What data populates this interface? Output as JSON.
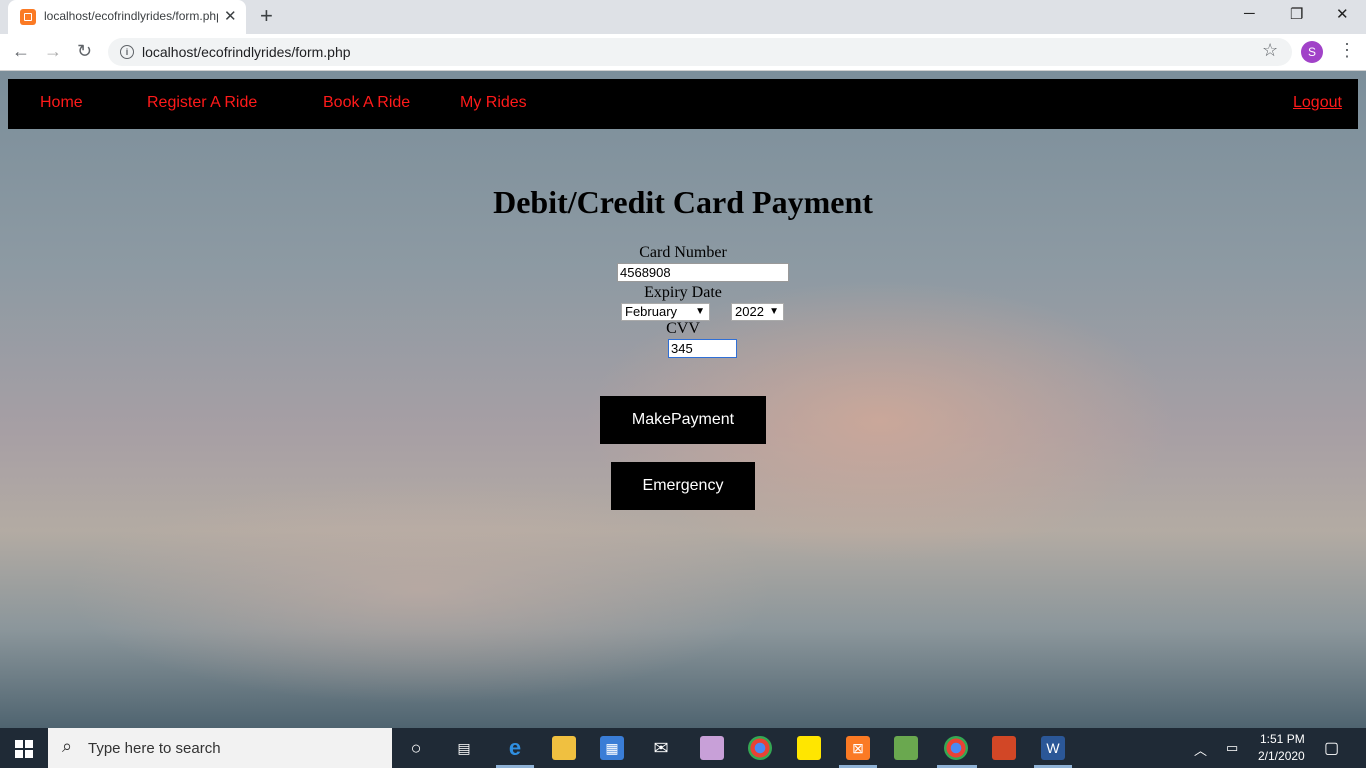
{
  "browser": {
    "tab_title": "localhost/ecofrindlyrides/form.php",
    "url": "localhost/ecofrindlyrides/form.php",
    "profile_initial": "S",
    "icons": [
      "favicon-icon",
      "close-icon",
      "plus-icon",
      "back-icon",
      "forward-icon",
      "reload-icon",
      "info-icon",
      "star-icon",
      "menu-icon",
      "minimize-icon",
      "restore-icon",
      "window-close-icon"
    ]
  },
  "nav": {
    "home": "Home",
    "register": "Register A Ride",
    "book": "Book A Ride",
    "rides": "My Rides",
    "logout": "Logout",
    "link_color": "#ff1a1a",
    "bar_color": "#000000"
  },
  "form": {
    "title": "Debit/Credit Card Payment",
    "card_label": "Card Number",
    "card_value": "4568908",
    "expiry_label": "Expiry Date",
    "month_value": "February",
    "year_value": "2022",
    "cvv_label": "CVV",
    "cvv_value": "345",
    "pay_button": "MakePayment",
    "emergency_button": "Emergency"
  },
  "taskbar": {
    "search_placeholder": "Type here to search",
    "time": "1:51 PM",
    "date": "2/1/2020",
    "apps": [
      "cortana-icon",
      "task-view-icon",
      "edge-icon",
      "file-explorer-icon",
      "store-icon",
      "mail-icon",
      "paint-icon",
      "chrome-icon",
      "sticky-notes-icon",
      "xampp-icon",
      "project-icon",
      "chrome-profile-icon",
      "powerpoint-icon",
      "word-icon"
    ]
  }
}
